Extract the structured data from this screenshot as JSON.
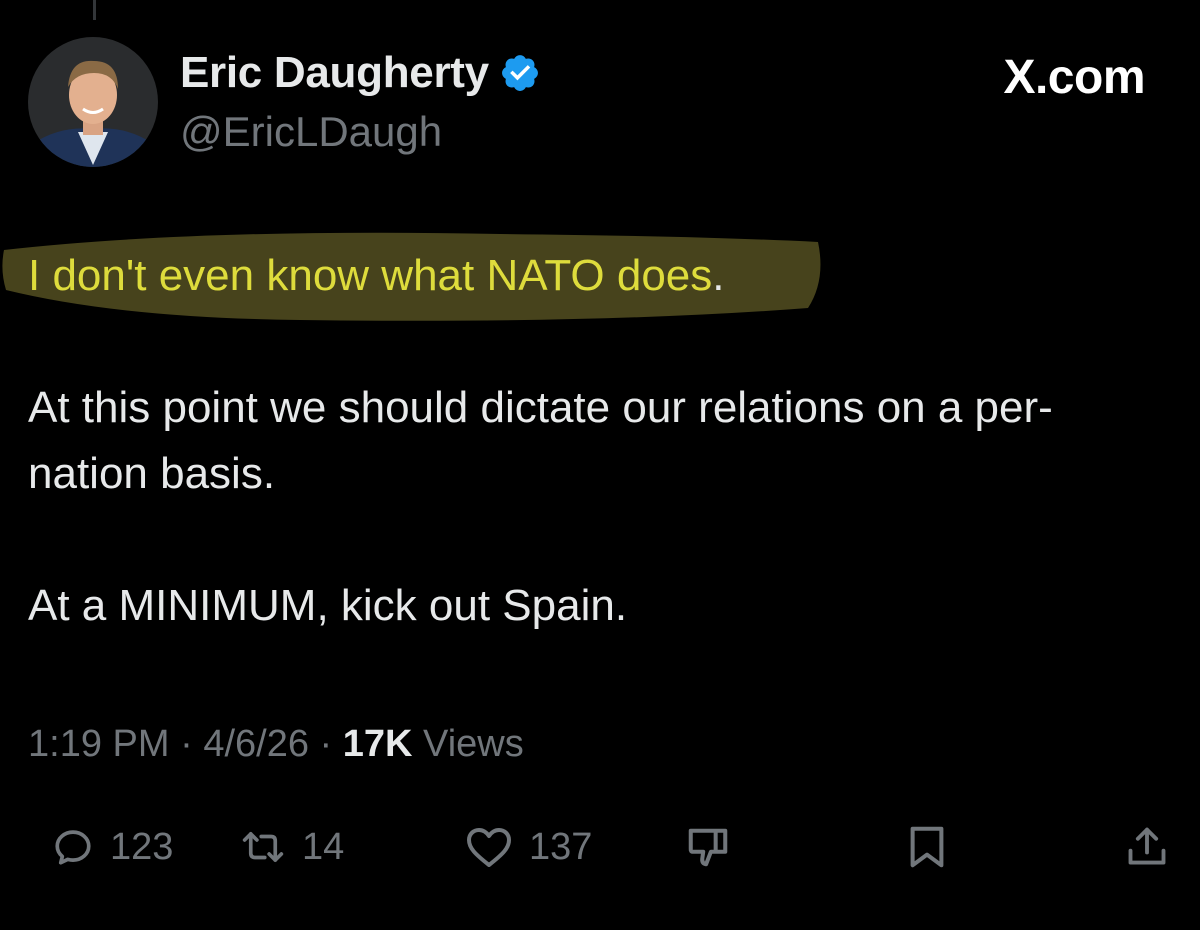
{
  "author": {
    "display_name": "Eric Daugherty",
    "handle": "@EricLDaugh",
    "verified": true
  },
  "brand": "X.com",
  "tweet": {
    "highlighted_text": "I don't even know what NATO does",
    "after_highlight": ".",
    "paragraph_2": "At this point we should dictate our relations on a per-nation basis.",
    "paragraph_3": "At a MINIMUM, kick out Spain."
  },
  "meta": {
    "time": "1:19 PM",
    "separator": "·",
    "date": "4/6/26",
    "views_count": "17K",
    "views_label": "Views"
  },
  "actions": {
    "replies": "123",
    "reposts": "14",
    "likes": "137"
  },
  "colors": {
    "background": "#000000",
    "text": "#e7e9ea",
    "secondary": "#71767b",
    "verified_blue": "#1d9bf0",
    "highlight": "#dedc3c"
  },
  "icons": {
    "verified": "verified-badge-icon",
    "reply": "reply-icon",
    "repost": "repost-icon",
    "like": "heart-icon",
    "dislike": "thumbs-down-icon",
    "bookmark": "bookmark-icon",
    "share": "share-icon"
  }
}
